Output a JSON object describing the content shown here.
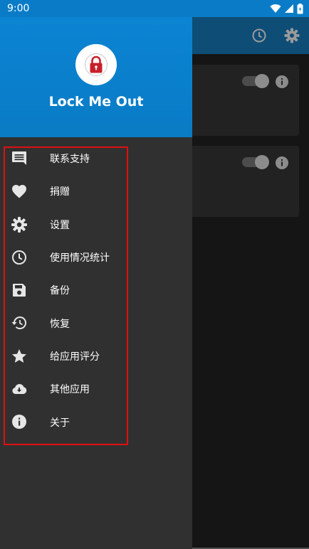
{
  "status_bar": {
    "time": "9:00",
    "icons": [
      "wifi-icon",
      "signal-icon",
      "battery-icon"
    ]
  },
  "app": {
    "toolbar_icons": [
      "history-icon",
      "gear-icon"
    ],
    "cards": [
      {
        "toggle": "off",
        "icon": "info-icon"
      },
      {
        "toggle": "off",
        "icon": "info-icon"
      }
    ]
  },
  "drawer": {
    "title": "Lock Me Out",
    "logo": "lock-icon",
    "items": [
      {
        "label": "联系支持",
        "icon": "message-icon"
      },
      {
        "label": "捐赠",
        "icon": "heart-icon"
      },
      {
        "label": "设置",
        "icon": "gear-icon"
      },
      {
        "label": "使用情况统计",
        "icon": "clock-icon"
      },
      {
        "label": "备份",
        "icon": "save-icon"
      },
      {
        "label": "恢复",
        "icon": "restore-icon"
      },
      {
        "label": "给应用评分",
        "icon": "star-icon"
      },
      {
        "label": "其他应用",
        "icon": "cloud-download-icon"
      },
      {
        "label": "关于",
        "icon": "info-icon"
      }
    ]
  },
  "colors": {
    "header_blue": "#0a80cf",
    "toolbar_dark_blue": "#0e4d76",
    "drawer_bg": "#303030",
    "highlight_red": "#e10f0f"
  }
}
